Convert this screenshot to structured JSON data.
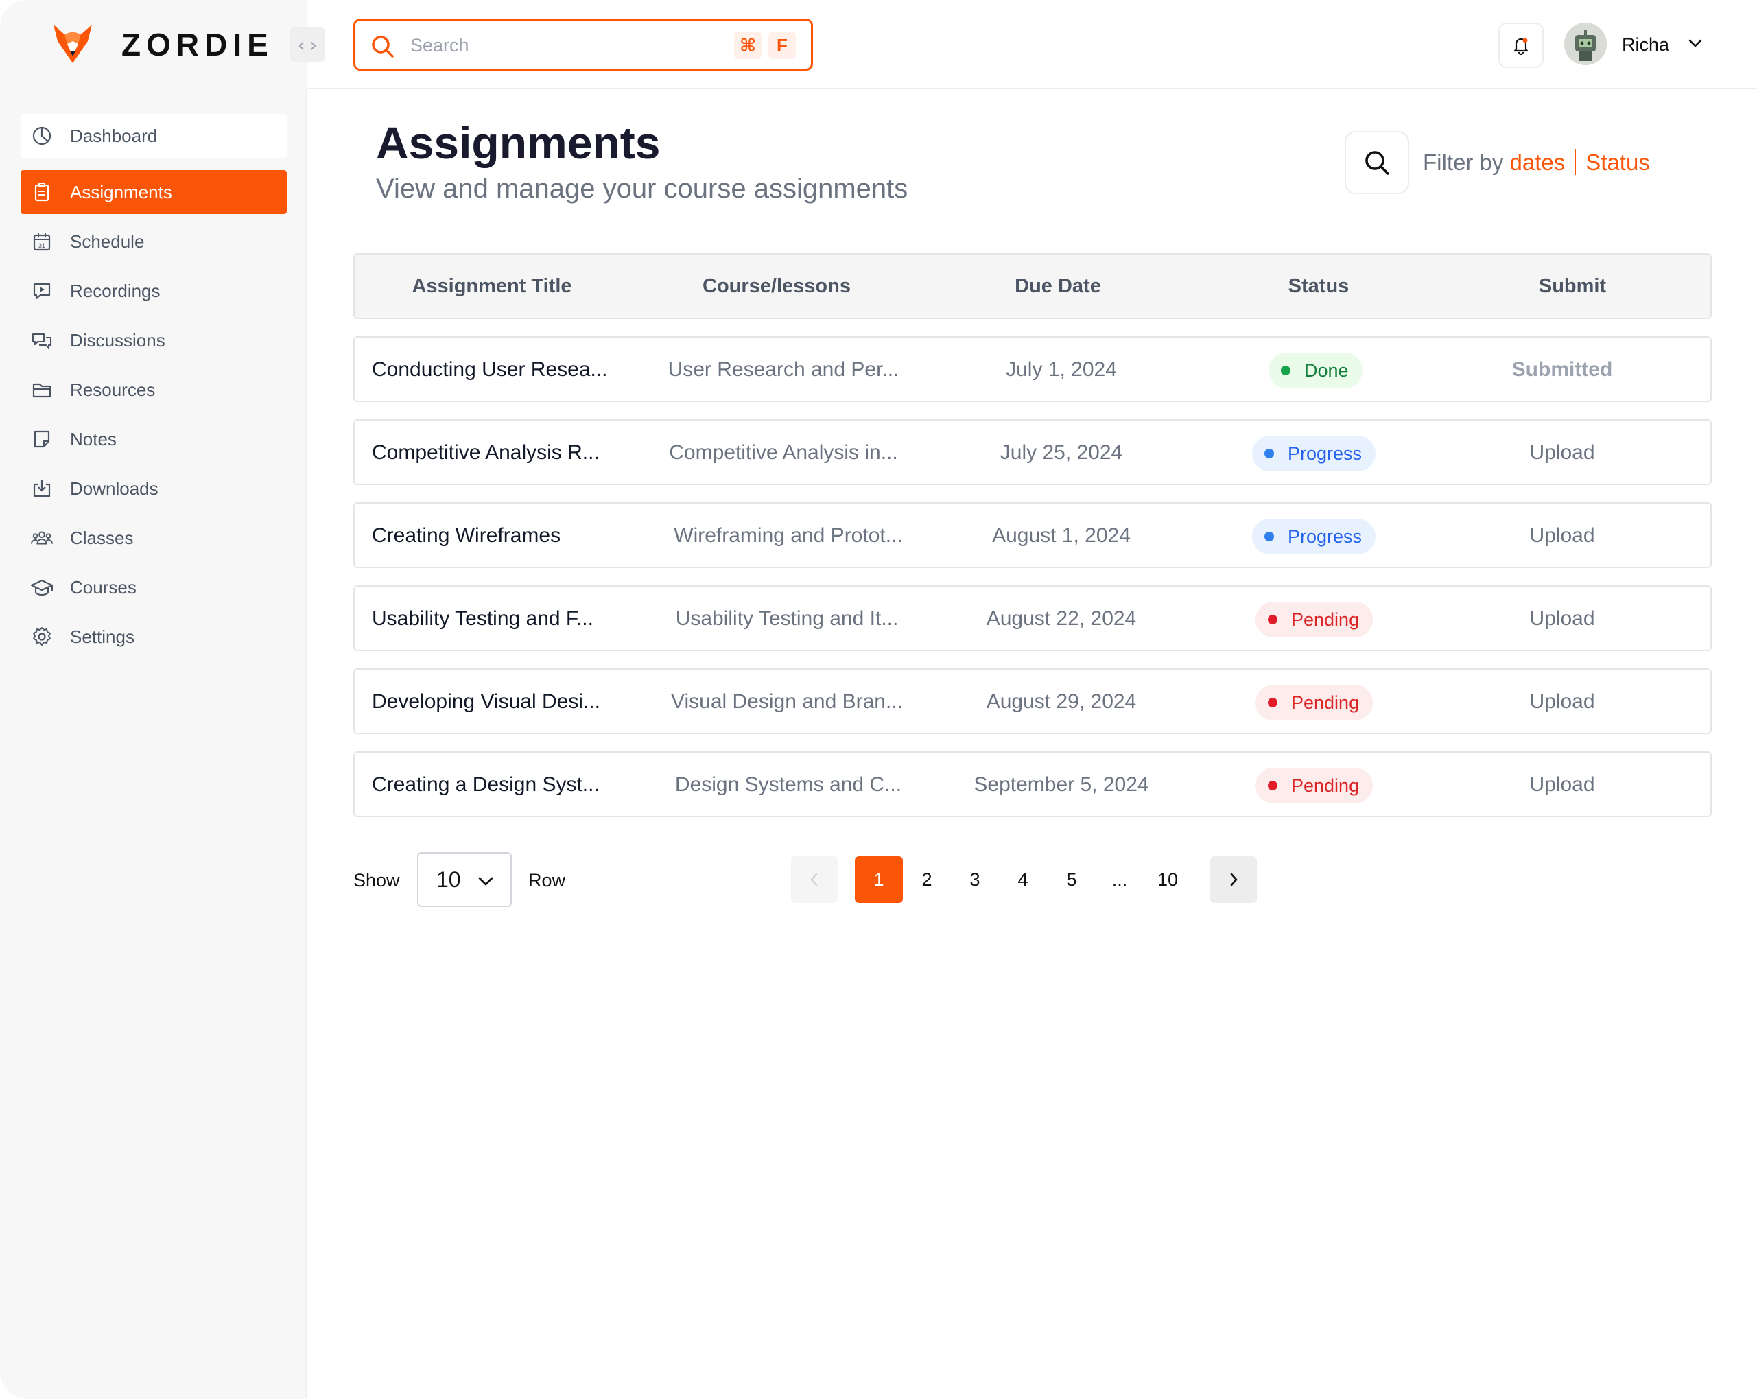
{
  "brand": {
    "name": "ZORDIE"
  },
  "colors": {
    "accent": "#fb5607",
    "done": "#16a34a",
    "progress": "#2f80ed",
    "pending": "#e11d2a"
  },
  "search": {
    "placeholder": "Search",
    "shortcut_modifier": "⌘",
    "shortcut_key": "F"
  },
  "user": {
    "name": "Richa"
  },
  "sidebar": {
    "items": [
      {
        "label": "Dashboard",
        "icon": "dashboard-icon"
      },
      {
        "label": "Assignments",
        "icon": "clipboard-icon",
        "active": true
      },
      {
        "label": "Schedule",
        "icon": "calendar-icon"
      },
      {
        "label": "Recordings",
        "icon": "recording-icon"
      },
      {
        "label": "Discussions",
        "icon": "chat-icon"
      },
      {
        "label": "Resources",
        "icon": "folder-icon"
      },
      {
        "label": "Notes",
        "icon": "note-icon"
      },
      {
        "label": "Downloads",
        "icon": "download-icon"
      },
      {
        "label": "Classes",
        "icon": "people-icon"
      },
      {
        "label": "Courses",
        "icon": "graduation-cap-icon"
      },
      {
        "label": "Settings",
        "icon": "gear-icon"
      }
    ]
  },
  "page": {
    "title": "Assignments",
    "subtitle": "View and manage your course assignments",
    "filter_prefix": "Filter by",
    "filter_dates": "dates",
    "filter_status": "Status"
  },
  "table": {
    "headers": {
      "title": "Assignment Title",
      "course": "Course/lessons",
      "due": "Due Date",
      "status": "Status",
      "submit": "Submit"
    },
    "rows": [
      {
        "title": "Conducting User Resea...",
        "course": "User Research and Per...",
        "due": "July 1, 2024",
        "status": "Done",
        "submit": "Submitted"
      },
      {
        "title": "Competitive Analysis R...",
        "course": "Competitive Analysis in...",
        "due": "July 25, 2024",
        "status": "Progress",
        "submit": "Upload"
      },
      {
        "title": "Creating Wireframes",
        "course": "Wireframing and Protot...",
        "due": "August 1, 2024",
        "status": "Progress",
        "submit": "Upload"
      },
      {
        "title": "Usability Testing and F...",
        "course": "Usability Testing and It...",
        "due": "August 22, 2024",
        "status": "Pending",
        "submit": "Upload"
      },
      {
        "title": "Developing Visual Desi...",
        "course": "Visual Design and Bran...",
        "due": "August 29, 2024",
        "status": "Pending",
        "submit": "Upload"
      },
      {
        "title": "Creating a Design Syst...",
        "course": "Design Systems and C...",
        "due": "September 5, 2024",
        "status": "Pending",
        "submit": "Upload"
      }
    ]
  },
  "pagination": {
    "show_label": "Show",
    "rows_value": "10",
    "row_label": "Row",
    "pages": [
      "1",
      "2",
      "3",
      "4",
      "5",
      "...",
      "10"
    ],
    "current": "1"
  }
}
